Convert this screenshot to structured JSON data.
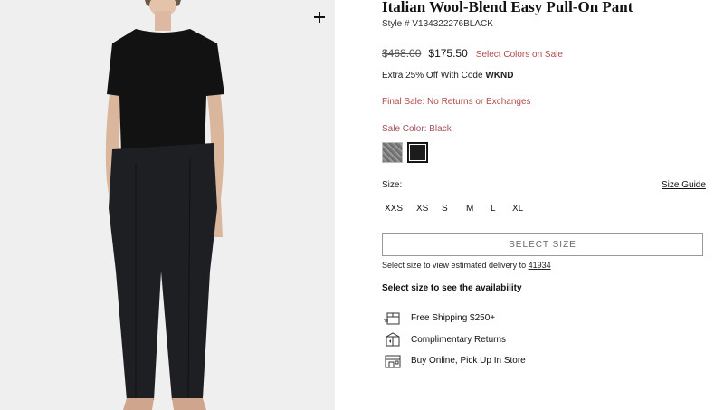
{
  "product": {
    "title": "Italian Wool-Blend Easy Pull-On Pant",
    "style_number": "Style # V134322276BLACK",
    "original_price": "$468.00",
    "sale_price": "$175.50",
    "sale_note": "Select Colors on Sale",
    "promo_prefix": "Extra 25% Off With Code ",
    "promo_code": "WKND",
    "final_sale": "Final Sale: No Returns or Exchanges",
    "color_label_prefix": "Sale Color: ",
    "selected_color": "Black",
    "swatches": [
      {
        "name": "Heather Grey",
        "icon": "heather-grey-swatch",
        "selected": false
      },
      {
        "name": "Black",
        "icon": "black-swatch",
        "selected": true
      }
    ],
    "size_label": "Size:",
    "size_guide": "Size Guide",
    "sizes": [
      "XXS",
      "XS",
      "S",
      "M",
      "L",
      "XL"
    ],
    "select_size_button": "SELECT SIZE",
    "delivery_prefix": "Select size to view estimated delivery to ",
    "zip": "41934",
    "availability": "Select size to see the availability"
  },
  "features": [
    {
      "icon": "shipping-box-icon",
      "label": "Free Shipping $250+"
    },
    {
      "icon": "returns-box-icon",
      "label": "Complimentary Returns"
    },
    {
      "icon": "store-pickup-icon",
      "label": "Buy Online, Pick Up In Store"
    }
  ],
  "colors": {
    "sale_red": "#b04a4a",
    "panel_bg": "#efefef"
  }
}
